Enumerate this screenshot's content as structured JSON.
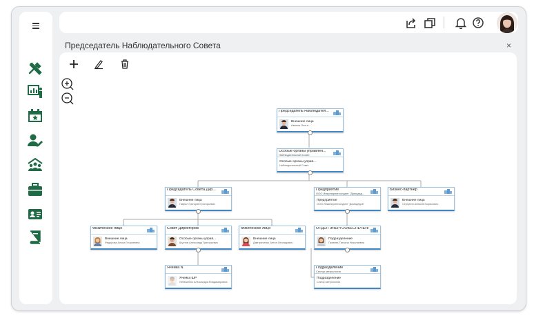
{
  "app": {
    "colors": {
      "accent": "#3f86c4",
      "icon_green": "#1f6b45",
      "frame": "#eef0f2"
    },
    "sidebar_icons": [
      "tools-icon",
      "presentation-icon",
      "calendar-icon",
      "user-edit-icon",
      "team-icon",
      "briefcase-icon",
      "id-card-icon",
      "book-icon"
    ],
    "topbar_icons": [
      "share-icon",
      "windows-icon",
      "bell-icon",
      "help-icon"
    ]
  },
  "panel": {
    "title": "Председатель Наблюдательного Совета",
    "close": "×"
  },
  "toolbar": [
    "add-icon",
    "edit-icon",
    "delete-icon",
    "zoom-in-icon",
    "zoom-out-icon"
  ],
  "nodes": [
    {
      "id": "n1",
      "title": "Председатель Наблюдател...",
      "sub": "",
      "line1": "Внешние лица",
      "line2": "Иванов Олеги...",
      "photo": "man"
    },
    {
      "id": "n2",
      "title": "Особые органы управлен...",
      "sub": "Наблюдательный Совет",
      "line1": "Особые органы управ...",
      "line2": "Наблюдательный Совет",
      "photo": ""
    },
    {
      "id": "n3",
      "title": "Председатель Совета Дир...",
      "sub": "",
      "line1": "Внешние лица",
      "line2": "Гаврил Григорий Григорьевич",
      "photo": "man"
    },
    {
      "id": "n4",
      "title": "Предприятие",
      "sub": "ООО Инжинирингхолдинг \"Домодед...",
      "line1": "Предприятие",
      "line2": "ООО Инжинирингхолдинг \"Домодедов\"",
      "photo": ""
    },
    {
      "id": "n5",
      "title": "Бизнес-партнер",
      "sub": "",
      "line1": "Внешние лица",
      "line2": "Сергунин Алексей Борисович",
      "photo": "man"
    },
    {
      "id": "n6",
      "title": "Физическое лицо",
      "sub": "",
      "line1": "Внешние лица",
      "line2": "Федорова Алиса Георгиевна",
      "photo": "woman"
    },
    {
      "id": "n7",
      "title": "Совет Директоров",
      "sub": "",
      "line1": "Особые органы управ...",
      "line2": "Шустов Александр Григорьевич",
      "photo": "man2"
    },
    {
      "id": "n8",
      "title": "Физическое лицо",
      "sub": "",
      "line1": "Внешние лица",
      "line2": "Дмитриченко Антон Леонидович",
      "photo": "girl"
    },
    {
      "id": "n9",
      "title": "ОТДЕЛ ЭНЕРГООБЕСПЕЧЕНИЯ",
      "sub": "",
      "line1": "Подразделение",
      "line2": "Галиева Татьяна Николаевна",
      "photo": "woman2"
    },
    {
      "id": "n10",
      "title": "Ячейка N",
      "sub": "",
      "line1": "Ячейка ШР",
      "line2": "Лебешенок Александра Владимировна",
      "photo": "oldman"
    },
    {
      "id": "n11",
      "title": "Подразделение",
      "sub": "Сектор метрологии",
      "line1": "Подразделение",
      "line2": "Сектор метрологии",
      "photo": ""
    }
  ]
}
